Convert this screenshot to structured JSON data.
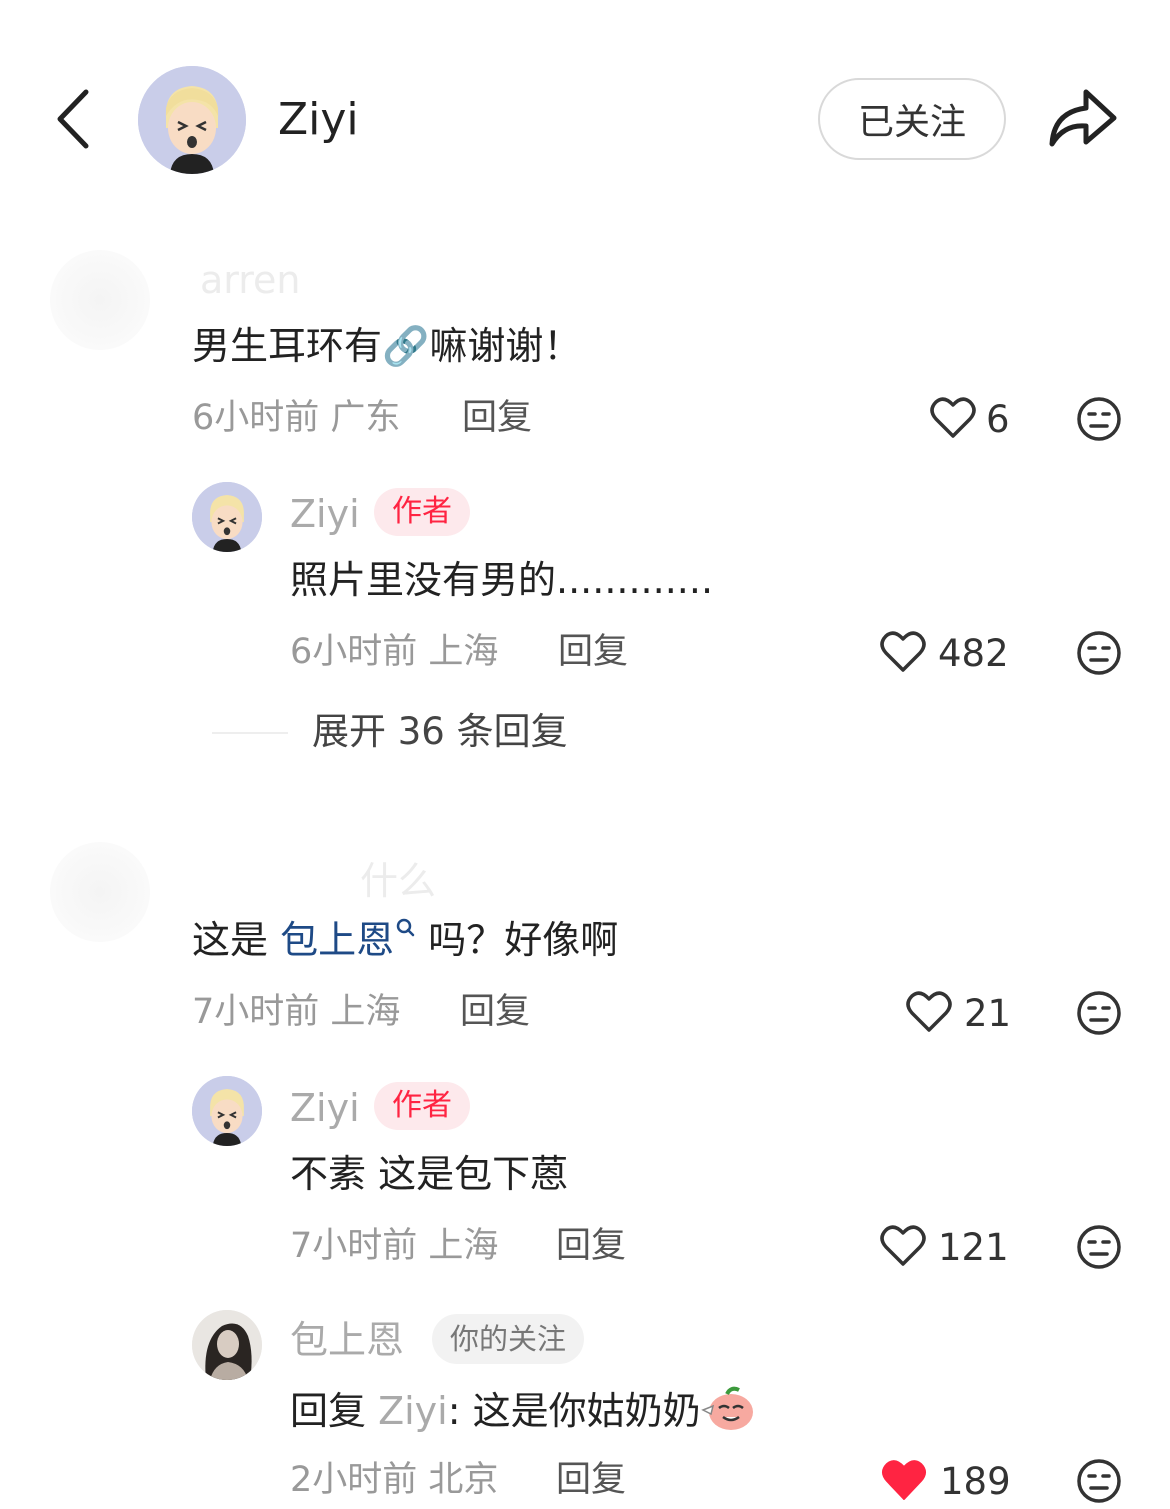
{
  "header": {
    "username": "Ziyi",
    "follow_label": "已关注"
  },
  "comments": [
    {
      "author_blurred": "arren",
      "text": "男生耳环有🔗嘛谢谢！",
      "time_loc": "6小时前 广东",
      "reply_label": "回复",
      "likes": "6",
      "replies": [
        {
          "author": "Ziyi",
          "badge": "作者",
          "text": "照片里没有男的.............",
          "time_loc": "6小时前 上海",
          "reply_label": "回复",
          "likes": "482"
        }
      ],
      "expand_label": "展开 36 条回复"
    },
    {
      "author_blurred": "什么",
      "text_prefix": "这是 ",
      "mention": "包上恩",
      "text_suffix": " 吗？好像啊",
      "time_loc": "7小时前 上海",
      "reply_label": "回复",
      "likes": "21",
      "replies": [
        {
          "author": "Ziyi",
          "badge": "作者",
          "text": "不素 这是包下蒽",
          "time_loc": "7小时前 上海",
          "reply_label": "回复",
          "likes": "121"
        },
        {
          "author": "包上恩",
          "badge": "你的关注",
          "reply_prefix": "回复 ",
          "reply_to": "Ziyi",
          "text": ": 这是你姑奶奶",
          "time_loc": "2小时前 北京",
          "reply_label": "回复",
          "likes": "189",
          "liked": true
        }
      ]
    }
  ],
  "colors": {
    "accent_red": "#ff2442",
    "mention_blue": "#1e4a86",
    "meta_gray": "#999999"
  },
  "icons": [
    "back-arrow-icon",
    "share-icon",
    "heart-icon",
    "heart-filled-icon",
    "dislike-face-icon",
    "search-mini-icon",
    "link-emoji-icon",
    "peach-emoji-icon"
  ]
}
